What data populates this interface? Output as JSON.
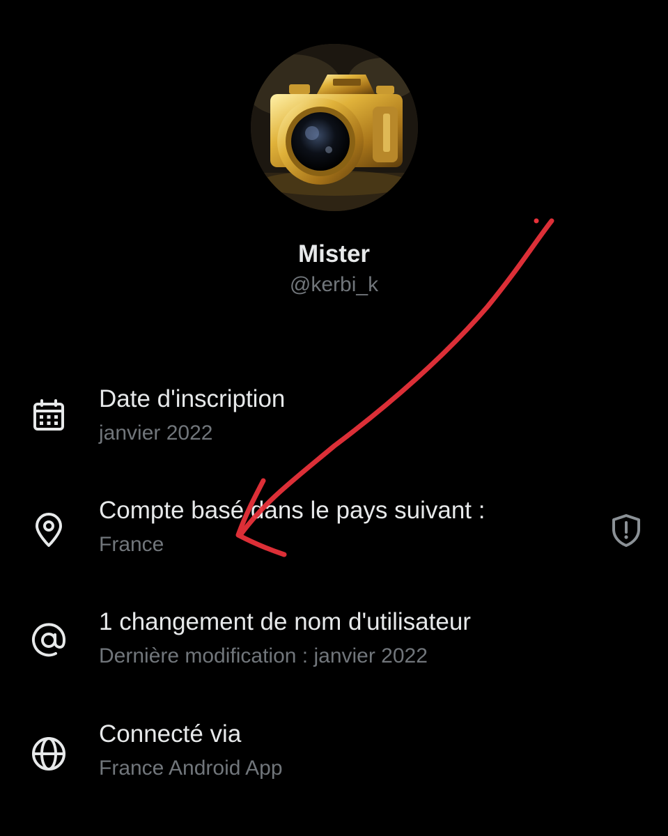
{
  "profile": {
    "display_name": "Mister",
    "handle": "@kerbi_k",
    "avatar_icon": "golden-camera-photo"
  },
  "about": [
    {
      "icon": "calendar-icon",
      "title": "Date d'inscription",
      "subtitle": "janvier 2022"
    },
    {
      "icon": "location-pin-icon",
      "title": "Compte basé dans le pays suivant :",
      "subtitle": "France",
      "trailing_icon": "shield-alert-icon"
    },
    {
      "icon": "at-sign-icon",
      "title": "1 changement de nom d'utilisateur",
      "subtitle": "Dernière modification : janvier 2022"
    },
    {
      "icon": "globe-icon",
      "title": "Connecté via",
      "subtitle": "France Android App"
    }
  ],
  "annotation": {
    "type": "hand-drawn-arrow",
    "color": "#e8323a"
  },
  "colors": {
    "background": "#000000",
    "primary_text": "#e7e9ea",
    "secondary_text": "#71767b"
  }
}
